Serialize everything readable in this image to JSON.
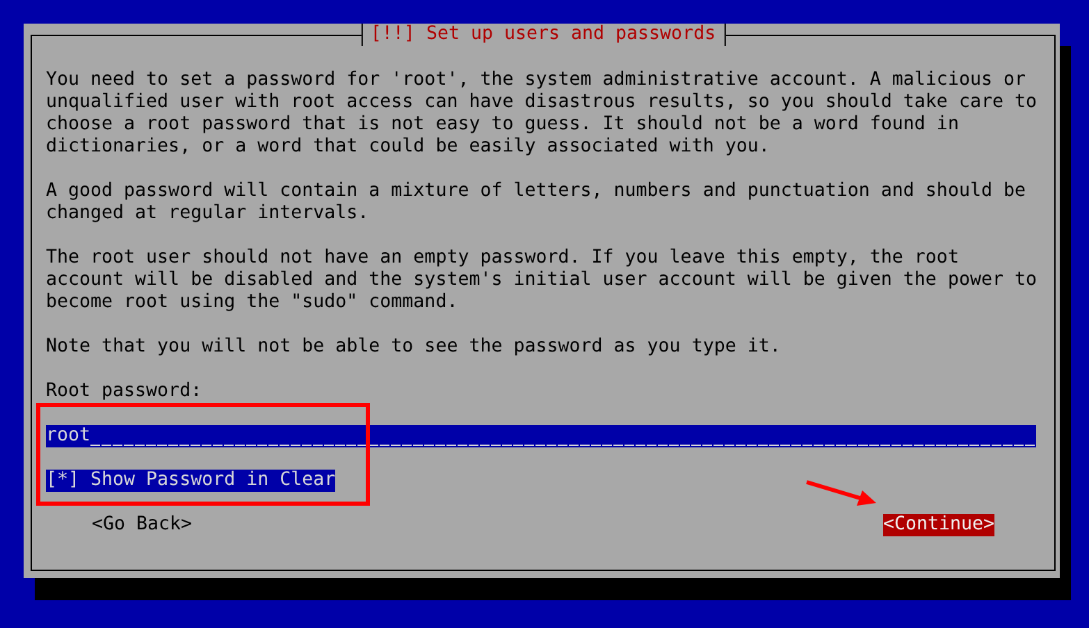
{
  "dialog": {
    "title": "[!!] Set up users and passwords",
    "paragraphs": [
      [
        "You need to set a password for 'root', the system administrative account. A malicious or",
        "unqualified user with root access can have disastrous results, so you should take care to",
        "choose a root password that is not easy to guess. It should not be a word found in",
        "dictionaries, or a word that could be easily associated with you."
      ],
      [
        "A good password will contain a mixture of letters, numbers and punctuation and should be",
        "changed at regular intervals."
      ],
      [
        "The root user should not have an empty password. If you leave this empty, the root",
        "account will be disabled and the system's initial user account will be given the power to",
        "become root using the \"sudo\" command."
      ],
      [
        "Note that you will not be able to see the password as you type it."
      ]
    ],
    "field": {
      "label": "Root password:",
      "value": "root"
    },
    "checkbox": {
      "box": "[*]",
      "label": "Show Password in Clear",
      "selected": true
    },
    "buttons": [
      {
        "label": "<Go Back>",
        "selected": false
      },
      {
        "label": "<Continue>",
        "selected": true
      }
    ]
  }
}
